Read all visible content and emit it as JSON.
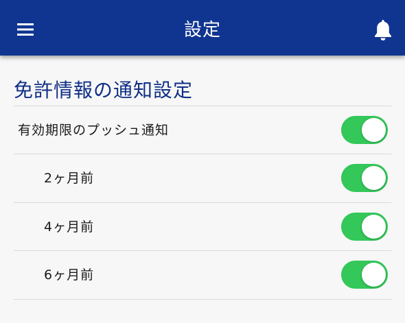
{
  "colors": {
    "header_bg": "#0f3590",
    "accent_title": "#102f86",
    "toggle_on": "#34c75a"
  },
  "header": {
    "title": "設定",
    "menu_icon": "hamburger-menu-icon",
    "notification_icon": "bell-icon"
  },
  "section": {
    "title": "免許情報の通知設定"
  },
  "settings": [
    {
      "label": "有効期限のプッシュ通知",
      "enabled": true
    },
    {
      "label": "2ヶ月前",
      "enabled": true
    },
    {
      "label": "4ヶ月前",
      "enabled": true
    },
    {
      "label": "6ヶ月前",
      "enabled": true
    }
  ]
}
